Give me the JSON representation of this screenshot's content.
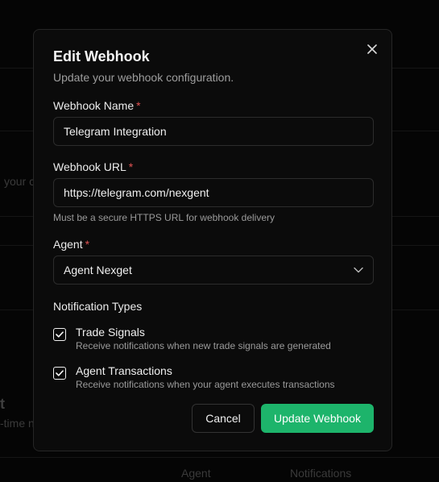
{
  "background": {
    "partial_text_1": "your c",
    "partial_heading": "t",
    "partial_text_2": "-time n",
    "col_agent": "Agent",
    "col_notifications": "Notifications"
  },
  "modal": {
    "title": "Edit Webhook",
    "subtitle": "Update your webhook configuration.",
    "close_icon": "close-icon",
    "name_field": {
      "label": "Webhook Name",
      "required_mark": "*",
      "value": "Telegram Integration"
    },
    "url_field": {
      "label": "Webhook URL",
      "required_mark": "*",
      "value": "https://telegram.com/nexgent",
      "hint": "Must be a secure HTTPS URL for webhook delivery"
    },
    "agent_field": {
      "label": "Agent",
      "required_mark": "*",
      "selected": "Agent Nexget",
      "icon": "chevron-down-icon"
    },
    "notifications": {
      "heading": "Notification Types",
      "items": [
        {
          "title": "Trade Signals",
          "description": "Receive notifications when new trade signals are generated",
          "checked": true
        },
        {
          "title": "Agent Transactions",
          "description": "Receive notifications when your agent executes transactions",
          "checked": true
        }
      ]
    },
    "buttons": {
      "cancel": "Cancel",
      "submit": "Update Webhook"
    }
  },
  "colors": {
    "accent": "#1db46b",
    "required": "#e05252",
    "surface": "#0b0b0b",
    "border": "#2c2c2c"
  }
}
